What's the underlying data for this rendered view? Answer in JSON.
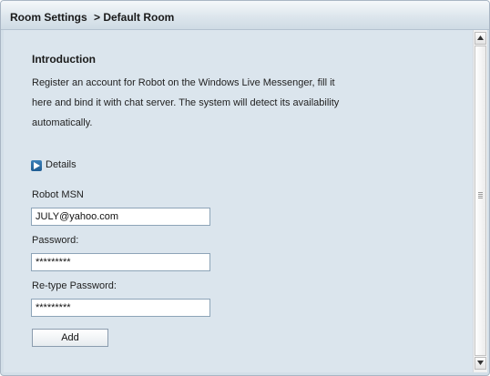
{
  "header": {
    "title": "Room Settings",
    "current": "> Default Room"
  },
  "introduction": {
    "heading": "Introduction",
    "line1": "Register an account for Robot on the Windows Live Messenger, fill it",
    "line2": "here and bind it with  chat server. The system will detect its availability",
    "line3": "automatically."
  },
  "details": {
    "label": "Details",
    "icon": "play-icon"
  },
  "form": {
    "msn_label": "Robot MSN",
    "msn_value": "JULY@yahoo.com",
    "password_label": "Password:",
    "password_value": "*********",
    "retype_label": "Re-type Password:",
    "retype_value": "*********",
    "add_label": "Add"
  },
  "colors": {
    "panel_bg": "#dbe5ed",
    "titlebar_bg": "#dde6ed",
    "border": "#a9b6c4"
  }
}
